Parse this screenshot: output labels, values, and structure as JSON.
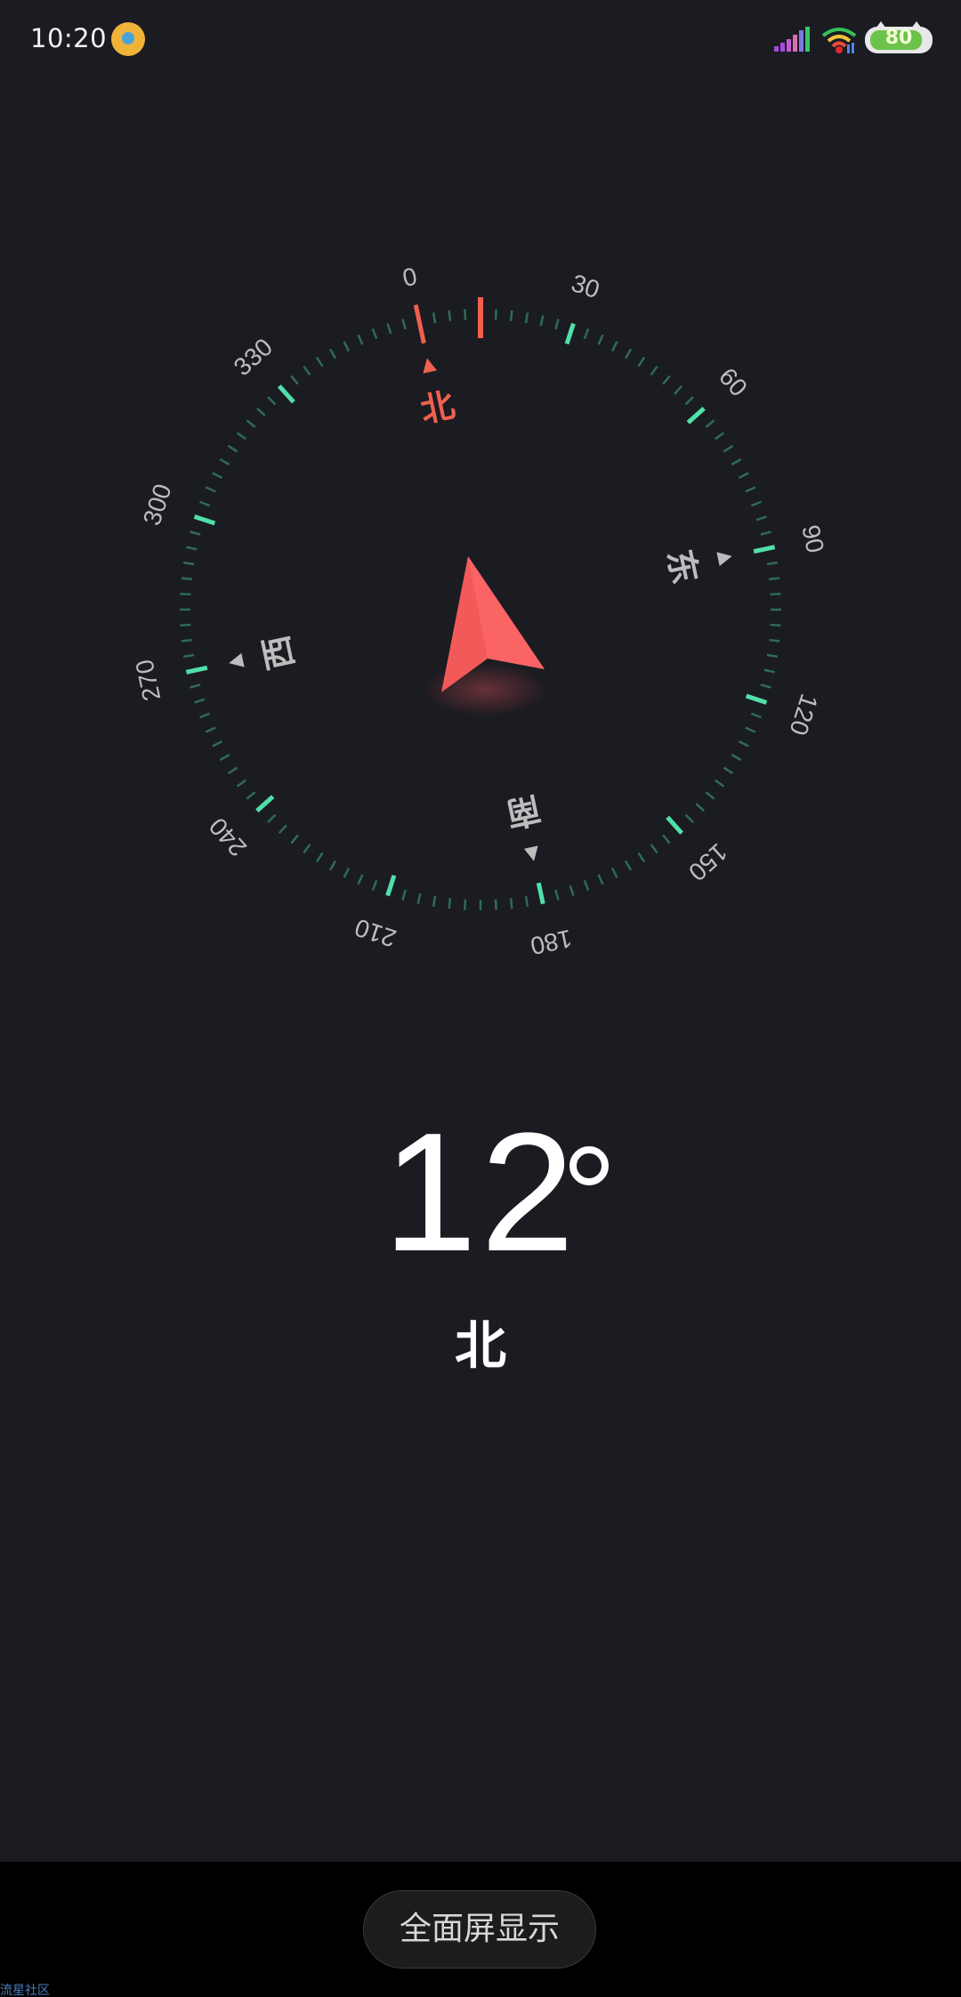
{
  "status_bar": {
    "time": "10:20",
    "battery_level": "80",
    "icons": [
      "app-notification-icon",
      "signal-icon",
      "wifi-icon",
      "battery-icon"
    ]
  },
  "compass": {
    "heading_degrees": 12,
    "degree_labels": [
      "0",
      "30",
      "60",
      "90",
      "120",
      "150",
      "180",
      "210",
      "240",
      "270",
      "300",
      "330"
    ],
    "cardinals": {
      "north": "北",
      "east": "东",
      "south": "南",
      "west": "西"
    },
    "colors": {
      "background": "#1b1b22",
      "tick_minor": "#2f6b55",
      "tick_major": "#4fe0a8",
      "north_accent": "#f0604f",
      "needle": "#f25a5a",
      "label": "#bdbdbd"
    }
  },
  "readout": {
    "value": "12",
    "direction": "北"
  },
  "bottom": {
    "fullscreen_label": "全面屏显示",
    "watermark": "流星社区"
  }
}
